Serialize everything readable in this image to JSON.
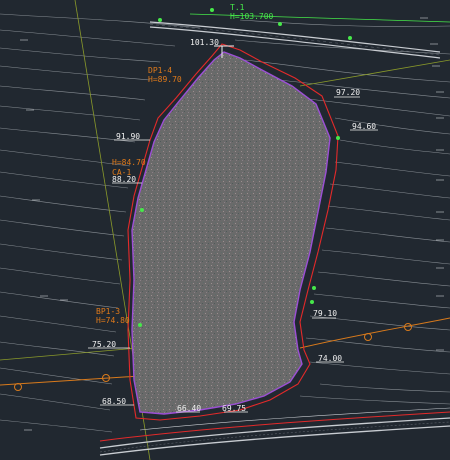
{
  "survey_point": {
    "name": "T.1",
    "elevation": "H=103.700"
  },
  "elevation_labels": {
    "crest": "101.30",
    "e97": "97.20",
    "e94": "94.60",
    "e91": "91.90",
    "e88": "88.20",
    "e79": "79.10",
    "e75": "75.20",
    "e74": "74.00",
    "e68": "68.50",
    "e69": "69.75",
    "e66": "66.40"
  },
  "annotations": {
    "dp1_a": "DP1-4",
    "dp1_b": "H=89.70",
    "ca": "CA-1",
    "cb": "H=84.70",
    "bp1_a": "BP1-3",
    "bp1_b": "H=74.80"
  },
  "colors": {
    "background": "#212830",
    "contour": "#9aa0a6",
    "boundary_red": "#e32a2a",
    "boundary_purple": "#9c4fd6",
    "orange_line": "#d87a1c",
    "olive_line": "#8a9a2a",
    "green": "#46e84a",
    "fill": "#6c6c6c"
  }
}
